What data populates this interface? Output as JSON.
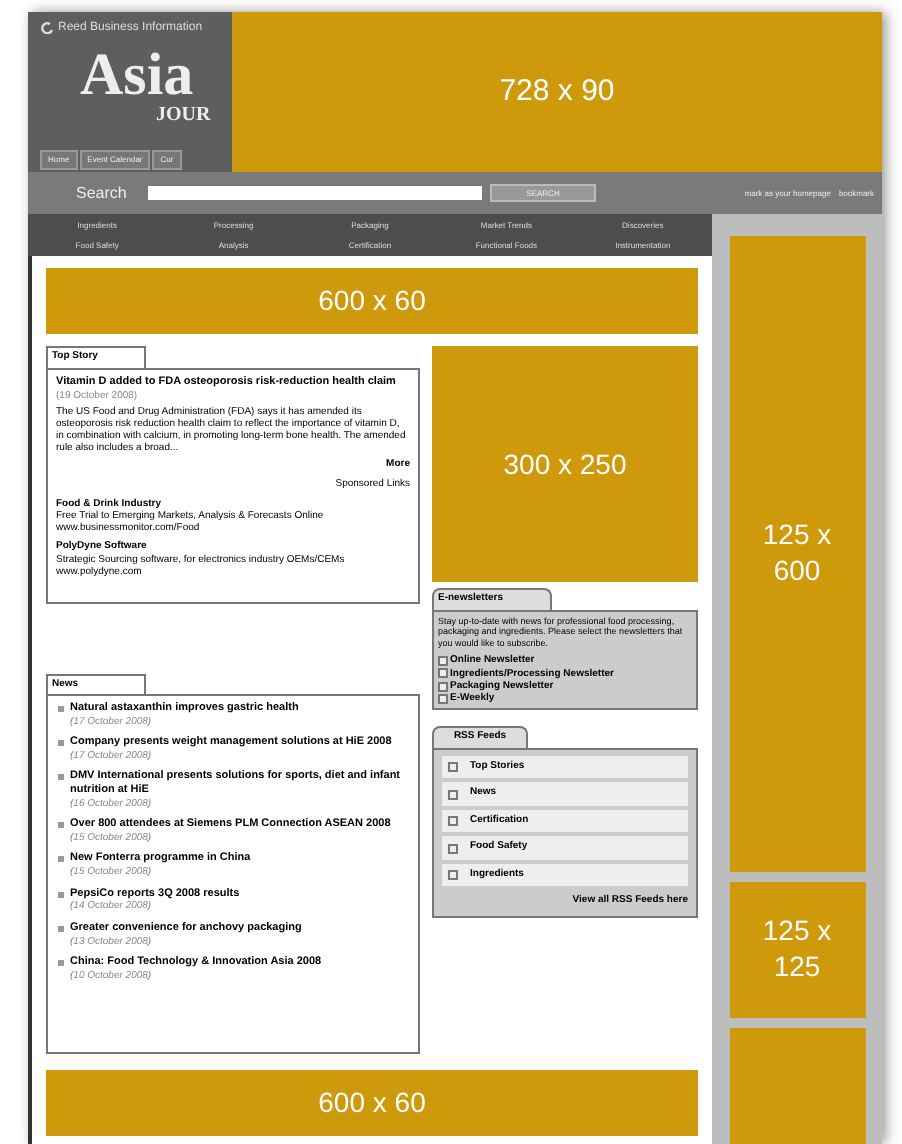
{
  "header": {
    "publisher": "Reed Business Information",
    "logo_title": "Asia",
    "logo_subtitle": "JOUR",
    "nav_tabs": [
      {
        "label": "Home"
      },
      {
        "label": "Event Calendar"
      },
      {
        "label": "Cur"
      }
    ],
    "ad": {
      "label": "728 x 90"
    }
  },
  "search": {
    "label": "Search",
    "button": "SEARCH",
    "links": [
      "mark as your homepage",
      "bookmark"
    ]
  },
  "categories": [
    "Ingredients",
    "Processing",
    "Packaging",
    "Market Trends",
    "Discoveries",
    "Food Safety",
    "Analysis",
    "Certification",
    "Functional Foods",
    "Instrumentation"
  ],
  "top_ad": {
    "label": "600 x 60"
  },
  "top_story": {
    "heading": "Top Story",
    "title": "Vitamin D added to FDA osteoporosis risk-reduction health claim",
    "date": "(19 October 2008)",
    "body": "The US Food and Drug Administration (FDA) says it has amended its osteoporosis risk reduction health claim to reflect the importance of vitamin D, in combination with calcium, in promoting long-term bone health. The amended rule also includes a broad...",
    "more": "More",
    "sponsored": "Sponsored Links",
    "sponsors": [
      {
        "title": "Food & Drink Industry",
        "text": "Free Trial to Emerging Markets, Analysis & Forecasts Online",
        "url": "www.businessmonitor.com/Food"
      },
      {
        "title": "PolyDyne Software",
        "text": "Strategic Sourcing software, for electronics industry OEMs/CEMs",
        "url": "www.polydyne.com"
      }
    ]
  },
  "news": {
    "heading": "News",
    "items": [
      {
        "title": "Natural astaxanthin improves gastric health",
        "date": "(17 October 2008)"
      },
      {
        "title": "Company presents weight management solutions at HiE 2008",
        "date": "(17 October 2008)"
      },
      {
        "title": "DMV International presents solutions for sports, diet and infant nutrition at HiE",
        "date": "(16 October 2008)"
      },
      {
        "title": "Over 800 attendees at Siemens PLM Connection ASEAN 2008",
        "date": "(15 October 2008)"
      },
      {
        "title": "New Fonterra programme in China",
        "date": "(15 October 2008)"
      },
      {
        "title": "PepsiCo reports 3Q 2008 results",
        "date": "(14 October 2008)"
      },
      {
        "title": "Greater convenience for anchovy packaging",
        "date": "(13 October 2008)"
      },
      {
        "title": "China: Food Technology & Innovation Asia 2008",
        "date": "(10 October 2008)"
      }
    ]
  },
  "box_ad": {
    "label": "300 x 250"
  },
  "newsletters": {
    "heading": "E-newsletters",
    "intro": "Stay up-to-date with news for professional food processing, packaging and ingredients. Please select the newsletters that you would like to subscribe.",
    "items": [
      {
        "label": "Online Newsletter",
        "checked": false
      },
      {
        "label": "Ingredients/Processing Newsletter",
        "checked": false
      },
      {
        "label": "Packaging Newsletter",
        "checked": false
      },
      {
        "label": "E-Weekly",
        "checked": false
      }
    ]
  },
  "rss": {
    "heading": "RSS Feeds",
    "items": [
      {
        "label": "Top Stories",
        "checked": false
      },
      {
        "label": "News",
        "checked": false
      },
      {
        "label": "Certification",
        "checked": false
      },
      {
        "label": "Food Safety",
        "checked": false
      },
      {
        "label": "Ingredients",
        "checked": false
      }
    ],
    "link": "View all RSS Feeds here"
  },
  "side_ads": [
    {
      "kind": "ad",
      "label": "125 x 600"
    },
    {
      "kind": "ad",
      "label": "125 x 125"
    },
    {
      "kind": "ad"
    }
  ],
  "bottom_ad": {
    "label": "600 x 60"
  }
}
